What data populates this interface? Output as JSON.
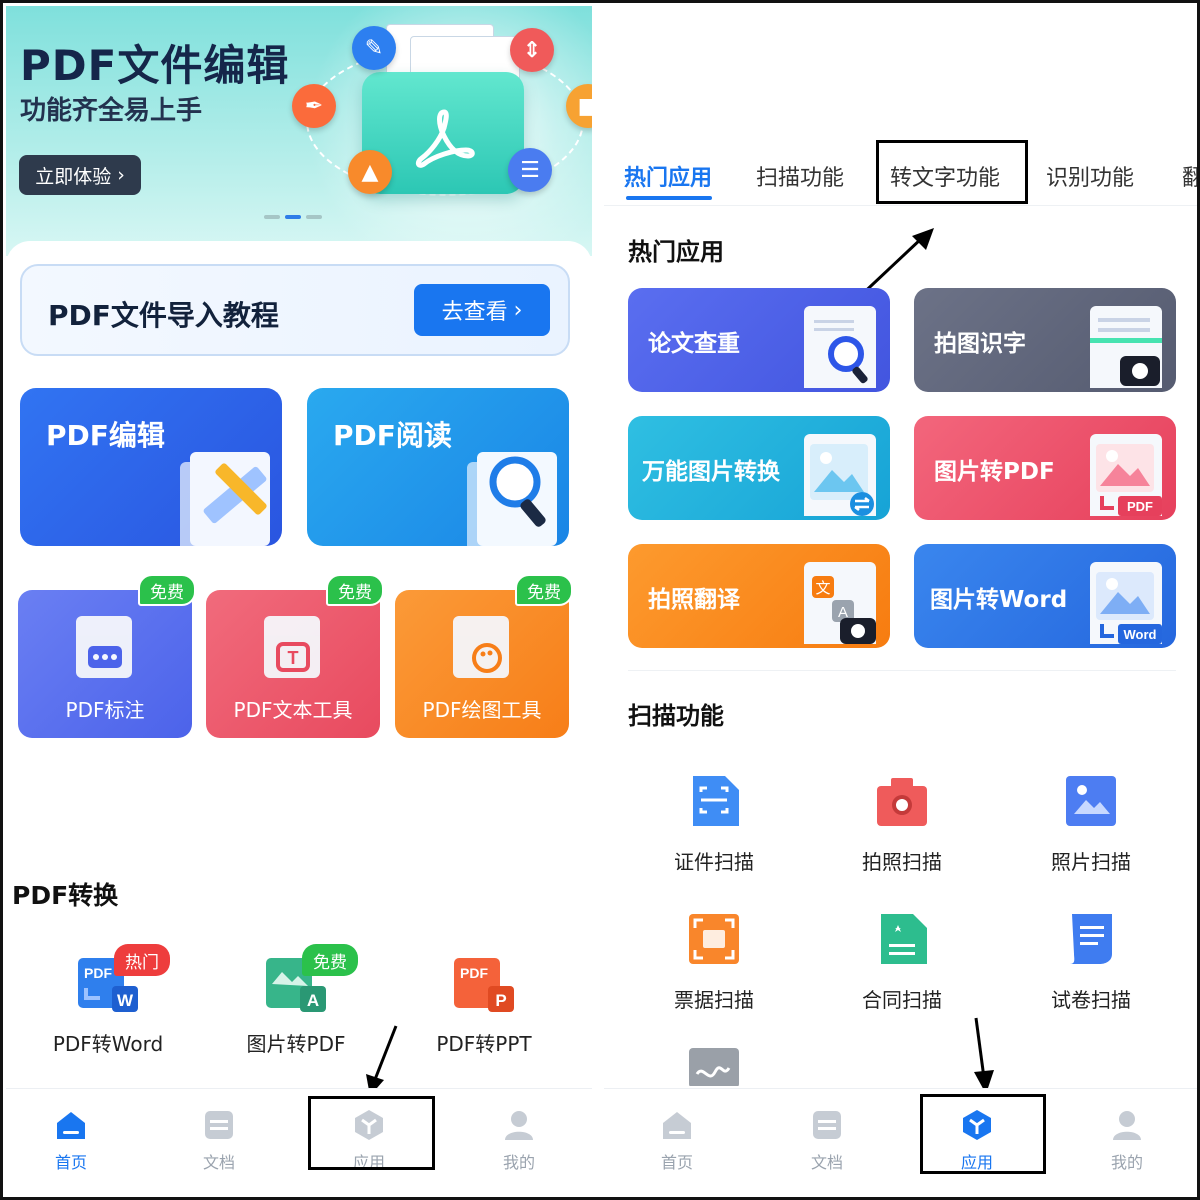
{
  "left": {
    "banner": {
      "title": "PDF文件编辑",
      "subtitle": "功能齐全易上手",
      "cta": "立即体验",
      "cta_chevron": "›"
    },
    "tutorial": {
      "title": "PDF文件导入教程",
      "button": "去查看",
      "button_chevron": "›"
    },
    "big_cards": [
      {
        "label": "PDF编辑",
        "color": "#2a61ea"
      },
      {
        "label": "PDF阅读",
        "color": "#1e9ae8"
      }
    ],
    "small_cards": [
      {
        "label": "PDF标注",
        "badge": "免费",
        "color": "#5b72ef"
      },
      {
        "label": "PDF文本工具",
        "badge": "免费",
        "color": "#ee5a6d"
      },
      {
        "label": "PDF绘图工具",
        "badge": "免费",
        "color": "#f98a25"
      }
    ],
    "conversion": {
      "heading": "PDF转换",
      "items": [
        {
          "label": "PDF转Word",
          "badge": "热门",
          "icon_text": "PDF",
          "sub_icon": "W"
        },
        {
          "label": "图片转PDF",
          "badge": "免费",
          "icon_text": "",
          "sub_icon": "A"
        },
        {
          "label": "PDF转PPT",
          "badge": "",
          "icon_text": "PDF",
          "sub_icon": "P"
        }
      ]
    },
    "nav": [
      {
        "label": "首页",
        "icon": "home-icon",
        "active": true
      },
      {
        "label": "文档",
        "icon": "document-icon",
        "active": false
      },
      {
        "label": "应用",
        "icon": "apps-cube-icon",
        "active": false
      },
      {
        "label": "我的",
        "icon": "profile-icon",
        "active": false
      }
    ]
  },
  "right": {
    "tabs": [
      "热门应用",
      "扫描功能",
      "转文字功能",
      "识别功能",
      "翻"
    ],
    "hot_heading": "热门应用",
    "hot_apps": [
      {
        "label": "论文查重",
        "color": "#4f63e6"
      },
      {
        "label": "拍图识字",
        "color": "#5f6579"
      },
      {
        "label": "万能图片转换",
        "color": "#22b3dc"
      },
      {
        "label": "图片转PDF",
        "color": "#ee5168",
        "tag": "PDF"
      },
      {
        "label": "拍照翻译",
        "color": "#fb8a1c"
      },
      {
        "label": "图片转Word",
        "color": "#2d79e6",
        "tag": "Word"
      }
    ],
    "scan_heading": "扫描功能",
    "scan_items": [
      {
        "label": "证件扫描",
        "color": "#3f8df5"
      },
      {
        "label": "拍照扫描",
        "color": "#ef5b5b"
      },
      {
        "label": "照片扫描",
        "color": "#4d7df2"
      },
      {
        "label": "票据扫描",
        "color": "#f9862b"
      },
      {
        "label": "合同扫描",
        "color": "#2dbd8e"
      },
      {
        "label": "试卷扫描",
        "color": "#3f7cf0"
      }
    ],
    "nav": [
      {
        "label": "首页",
        "icon": "home-icon",
        "active": false
      },
      {
        "label": "文档",
        "icon": "document-icon",
        "active": false
      },
      {
        "label": "应用",
        "icon": "apps-cube-icon",
        "active": true
      },
      {
        "label": "我的",
        "icon": "profile-icon",
        "active": false
      }
    ]
  }
}
